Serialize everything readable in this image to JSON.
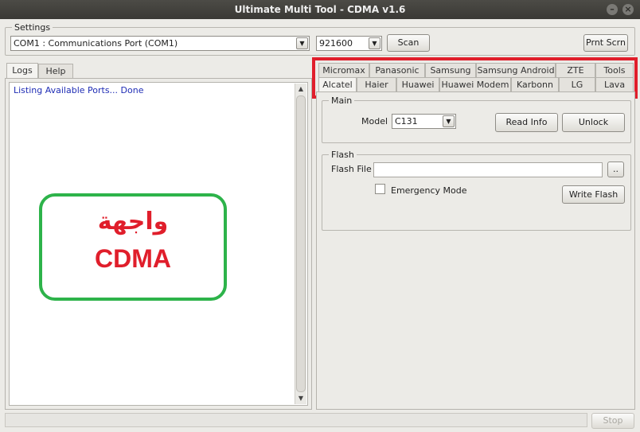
{
  "window": {
    "title": "Ultimate Multi Tool - CDMA v1.6"
  },
  "settings": {
    "group_label": "Settings",
    "port_value": "COM1 : Communications Port (COM1)",
    "baud_value": "921600",
    "scan_label": "Scan",
    "print_screen_label": "Prnt Scrn"
  },
  "left_tabs": [
    {
      "label": "Logs"
    },
    {
      "label": "Help"
    }
  ],
  "log": {
    "lines": [
      "Listing Available Ports... Done"
    ]
  },
  "overlay": {
    "arabic": "واجهة",
    "english": "CDMA"
  },
  "brand_tabs_row1": [
    {
      "label": "Micromax"
    },
    {
      "label": "Panasonic"
    },
    {
      "label": "Samsung"
    },
    {
      "label": "Samsung Android"
    },
    {
      "label": "ZTE"
    },
    {
      "label": "Tools"
    }
  ],
  "brand_tabs_row2": [
    {
      "label": "Alcatel"
    },
    {
      "label": "Haier"
    },
    {
      "label": "Huawei"
    },
    {
      "label": "Huawei Modem"
    },
    {
      "label": "Karbonn"
    },
    {
      "label": "LG"
    },
    {
      "label": "Lava"
    }
  ],
  "main_group": {
    "label": "Main",
    "model_label": "Model",
    "model_value": "C131",
    "read_info_label": "Read Info",
    "unlock_label": "Unlock"
  },
  "flash_group": {
    "label": "Flash",
    "file_label": "Flash File",
    "file_value": "",
    "browse_label": "..",
    "emergency_label": "Emergency Mode",
    "write_flash_label": "Write Flash"
  },
  "footer": {
    "stop_label": "Stop"
  },
  "colors": {
    "highlight": "#e01e2b",
    "overlay_box": "#2db34a",
    "log_text": "#1f2db5"
  }
}
